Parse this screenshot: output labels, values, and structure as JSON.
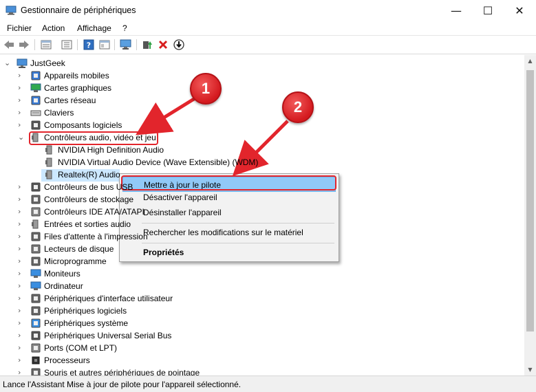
{
  "window": {
    "title": "Gestionnaire de périphériques",
    "controls": {
      "minimize": "—",
      "maximize": "☐",
      "close": "✕"
    }
  },
  "menubar": {
    "items": [
      {
        "label": "Fichier"
      },
      {
        "label": "Action"
      },
      {
        "label": "Affichage"
      },
      {
        "label": "?"
      }
    ]
  },
  "toolbar": {
    "icons": [
      "back-icon",
      "forward-icon",
      "properties-icon",
      "view-list-icon",
      "help-icon",
      "view-icon",
      "scan-hardware-icon",
      "update-driver-icon",
      "uninstall-icon",
      "download-icon"
    ]
  },
  "tree": {
    "root": "JustGeek",
    "items": [
      {
        "label": "Appareils mobiles",
        "icon": "mobile-device-icon",
        "expander": "›"
      },
      {
        "label": "Cartes graphiques",
        "icon": "display-adapter-icon",
        "expander": "›"
      },
      {
        "label": "Cartes réseau",
        "icon": "network-adapter-icon",
        "expander": "›"
      },
      {
        "label": "Claviers",
        "icon": "keyboard-icon",
        "expander": "›"
      },
      {
        "label": "Composants logiciels",
        "icon": "software-component-icon",
        "expander": "›"
      },
      {
        "label": "Contrôleurs audio, vidéo et jeu",
        "icon": "speaker-icon",
        "expander": "⌄"
      },
      {
        "label": "NVIDIA High Definition Audio",
        "icon": "speaker-icon",
        "child": true
      },
      {
        "label": "NVIDIA Virtual Audio Device (Wave Extensible) (WDM)",
        "icon": "speaker-icon",
        "child": true
      },
      {
        "label": "Realtek(R) Audio",
        "icon": "speaker-icon",
        "child": true,
        "selected": true
      },
      {
        "label": "Contrôleurs de bus USB",
        "icon": "usb-icon",
        "expander": "›"
      },
      {
        "label": "Contrôleurs de stockage",
        "icon": "storage-controller-icon",
        "expander": "›"
      },
      {
        "label": "Contrôleurs IDE ATA/ATAPI",
        "icon": "ide-icon",
        "expander": "›"
      },
      {
        "label": "Entrées et sorties audio",
        "icon": "audio-io-icon",
        "expander": "›"
      },
      {
        "label": "Files d'attente à l'impression",
        "icon": "printer-icon",
        "expander": "›"
      },
      {
        "label": "Lecteurs de disque",
        "icon": "disk-drive-icon",
        "expander": "›"
      },
      {
        "label": "Microprogramme",
        "icon": "firmware-icon",
        "expander": "›"
      },
      {
        "label": "Moniteurs",
        "icon": "monitor-icon",
        "expander": "›"
      },
      {
        "label": "Ordinateur",
        "icon": "computer-icon",
        "expander": "›"
      },
      {
        "label": "Périphériques d'interface utilisateur",
        "icon": "hid-icon",
        "expander": "›"
      },
      {
        "label": "Périphériques logiciels",
        "icon": "software-device-icon",
        "expander": "›"
      },
      {
        "label": "Périphériques système",
        "icon": "system-device-icon",
        "expander": "›"
      },
      {
        "label": "Périphériques Universal Serial Bus",
        "icon": "usb-device-icon",
        "expander": "›"
      },
      {
        "label": "Ports (COM et LPT)",
        "icon": "port-icon",
        "expander": "›"
      },
      {
        "label": "Processeurs",
        "icon": "processor-icon",
        "expander": "›"
      },
      {
        "label": "Souris et autres périphériques de pointage",
        "icon": "mouse-icon",
        "expander": "›"
      }
    ]
  },
  "context_menu": {
    "items": [
      {
        "label": "Mettre à jour le pilote",
        "highlighted": true
      },
      {
        "label": "Désactiver l'appareil"
      },
      {
        "label": "Désinstaller l'appareil"
      },
      {
        "label": "Rechercher les modifications sur le matériel"
      },
      {
        "label": "Propriétés",
        "bold": true
      }
    ]
  },
  "statusbar": {
    "text": "Lance l'Assistant Mise à jour de pilote pour l'appareil sélectionné."
  },
  "annotations": {
    "badge1": "1",
    "badge2": "2"
  },
  "colors": {
    "annotation_red": "#e2252c",
    "highlight_blue": "#91c9f7",
    "selection": "#cce8ff"
  }
}
